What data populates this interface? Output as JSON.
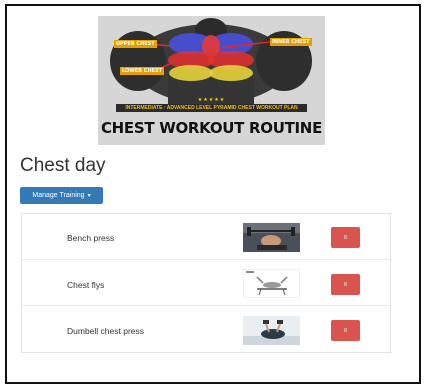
{
  "banner": {
    "title": "CHEST WORKOUT ROUTINE",
    "subtitle": "INTERMEDIATE · ADVANCED LEVEL PYRAMID CHEST WORKOUT PLAN",
    "stars": "★★★★★",
    "labels": {
      "upper": "UPPER CHEST",
      "inner": "INNER CHEST",
      "lower": "LOWER CHEST"
    }
  },
  "page": {
    "title": "Chest day"
  },
  "toolbar": {
    "manage_label": "Manage Training"
  },
  "exercises": [
    {
      "name": "Bench press",
      "delete_label": "x"
    },
    {
      "name": "Chest flys",
      "delete_label": "x"
    },
    {
      "name": "Dumbell chest press",
      "delete_label": "x"
    }
  ],
  "colors": {
    "primary": "#337ab7",
    "danger": "#d9534f",
    "accent": "#e5a000"
  }
}
